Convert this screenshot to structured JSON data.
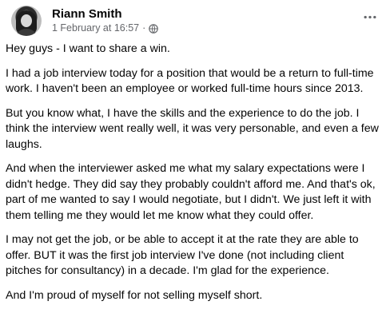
{
  "post": {
    "author": "Riann Smith",
    "timestamp": "1 February at 16:57",
    "separator": "·",
    "audience_icon": "globe-icon",
    "menu_icon": "more-options-icon",
    "paragraphs": [
      "Hey guys - I want to share a win.",
      "I had a job interview today for a position that would be a return to full-time work. I haven't been an employee or worked full-time hours since 2013.",
      "But you know what, I have the skills and the experience to do the job. I think the interview went really well, it was very personable, and even a few laughs.",
      "And when the interviewer asked me what my salary expectations were I didn't hedge. They did say they probably couldn't afford me. And that's ok, part of me wanted to say I would negotiate, but I didn't. We just left it with them telling me they would let me know what they could offer.",
      "I may not get the job, or be able to accept it at the rate they are able to offer. BUT it was the first job interview I've done (not including client pitches for consultancy) in a decade. I'm glad for the experience.",
      "And I'm proud of myself for not selling myself short."
    ]
  },
  "colors": {
    "text": "#050505",
    "secondary_text": "#65676b",
    "background": "#ffffff"
  }
}
